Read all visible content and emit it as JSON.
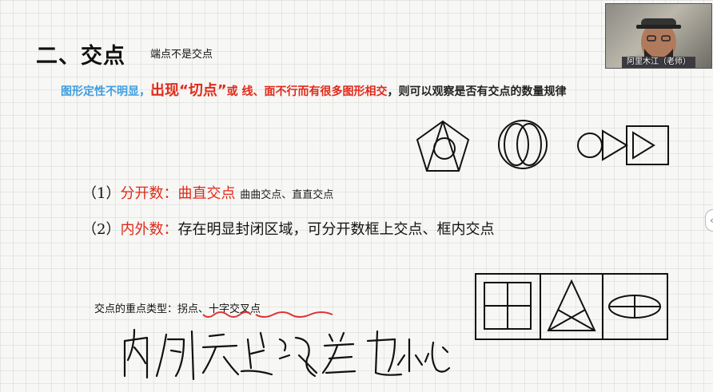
{
  "slide": {
    "title": "二、交点",
    "subtitle": "端点不是交点",
    "line2": {
      "part_blue": "图形定性不明显，",
      "part_red_big": "出现“切点”",
      "part_red_small": "或  线、面不行而有很多图形相交",
      "part_dark": "，则可以观察是否有交点的数量规律"
    },
    "item1": {
      "num": "（1）",
      "label": "分开数：",
      "highlight": "曲直交点",
      "note": "曲曲交点、直直交点"
    },
    "item2": {
      "num": "（2）",
      "label": "内外数：",
      "text": "存在明显封闭区域，可分开数框上交点、框内交点"
    },
    "types": {
      "prefix": "交点的重点类型：",
      "value": "拐点、十字交叉点"
    }
  },
  "webcam": {
    "name": "阿里木江（老师）"
  },
  "colors": {
    "blue": "#3e9ee0",
    "red": "#e02a1a",
    "annotation_red": "#d33"
  },
  "icons": [
    "chevron-left-icon"
  ]
}
